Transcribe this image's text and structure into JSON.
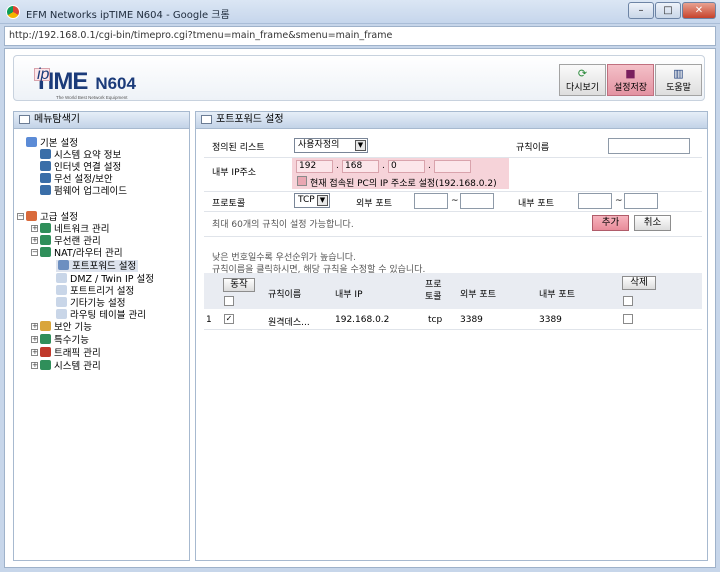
{
  "window": {
    "title": "EFM Networks ipTIME N604 - Google 크롬",
    "url": "http://192.168.0.1/cgi-bin/timepro.cgi?tmenu=main_frame&smenu=main_frame"
  },
  "header": {
    "logo_ip": "ip",
    "logo_time": "TIME",
    "model": "N604",
    "tagline": "The World Best Network Equipment",
    "buttons": [
      {
        "label": "다시보기",
        "icon": "refresh-icon"
      },
      {
        "label": "설정저장",
        "icon": "save-icon"
      },
      {
        "label": "도움말",
        "icon": "book-icon"
      }
    ]
  },
  "sidebar": {
    "title": "메뉴탐색기",
    "basic": {
      "label": "기본 설정",
      "items": [
        "시스템 요약 정보",
        "인터넷 연결 설정",
        "무선 설정/보안",
        "펌웨어 업그레이드"
      ]
    },
    "advanced": {
      "label": "고급 설정",
      "network": "네트워크 관리",
      "wireless": "무선랜 관리",
      "nat": "NAT/라우터 관리",
      "nat_items": [
        "포트포워드 설정",
        "DMZ / Twin IP 설정",
        "포트트리거 설정",
        "기타기능 설정",
        "라우팅 테이블 관리"
      ],
      "rest": [
        "보안 기능",
        "특수기능",
        "트래픽 관리",
        "시스템 관리"
      ]
    }
  },
  "main": {
    "title": "포트포워드 설정",
    "rule_list_label": "정의된 리스트",
    "rule_list_value": "사용자정의",
    "rule_name_label": "규칙이름",
    "rule_name_value": "",
    "ip_label": "내부 IP주소",
    "ip": [
      "192",
      "168",
      "0",
      ""
    ],
    "ip_sep": ".",
    "current_ip_text": "현재 접속된 PC의 IP 주소로 설정(192.168.0.2)",
    "protocol_label": "프로토콜",
    "protocol_value": "TCP",
    "ext_port_label": "외부 포트",
    "int_port_label": "내부 포트",
    "range_sep": "~",
    "max_note": "최대 60개의 규칙이 설정 가능합니다.",
    "add_label": "추가",
    "cancel_label": "취소",
    "priority_note": "낮은 번호일수록 우선순위가 높습니다.",
    "edit_note": "규칙이름을 클릭하시면, 해당 규칙을 수정할 수 있습니다.",
    "table": {
      "action_label": "동작",
      "delete_label": "삭제",
      "headers": {
        "name": "규칙이름",
        "ip": "내부 IP",
        "proto": "프로\n토콜",
        "ext": "외부 포트",
        "int": "내부 포트"
      },
      "rows": [
        {
          "no": "1",
          "checked": true,
          "name": "원격데스...",
          "ip": "192.168.0.2",
          "proto": "tcp",
          "ext": "3389",
          "int": "3389"
        }
      ]
    }
  },
  "colors": {
    "accent": "#e88c9a",
    "panel_head": "#c3d3e7",
    "brand": "#1b3b7a"
  }
}
